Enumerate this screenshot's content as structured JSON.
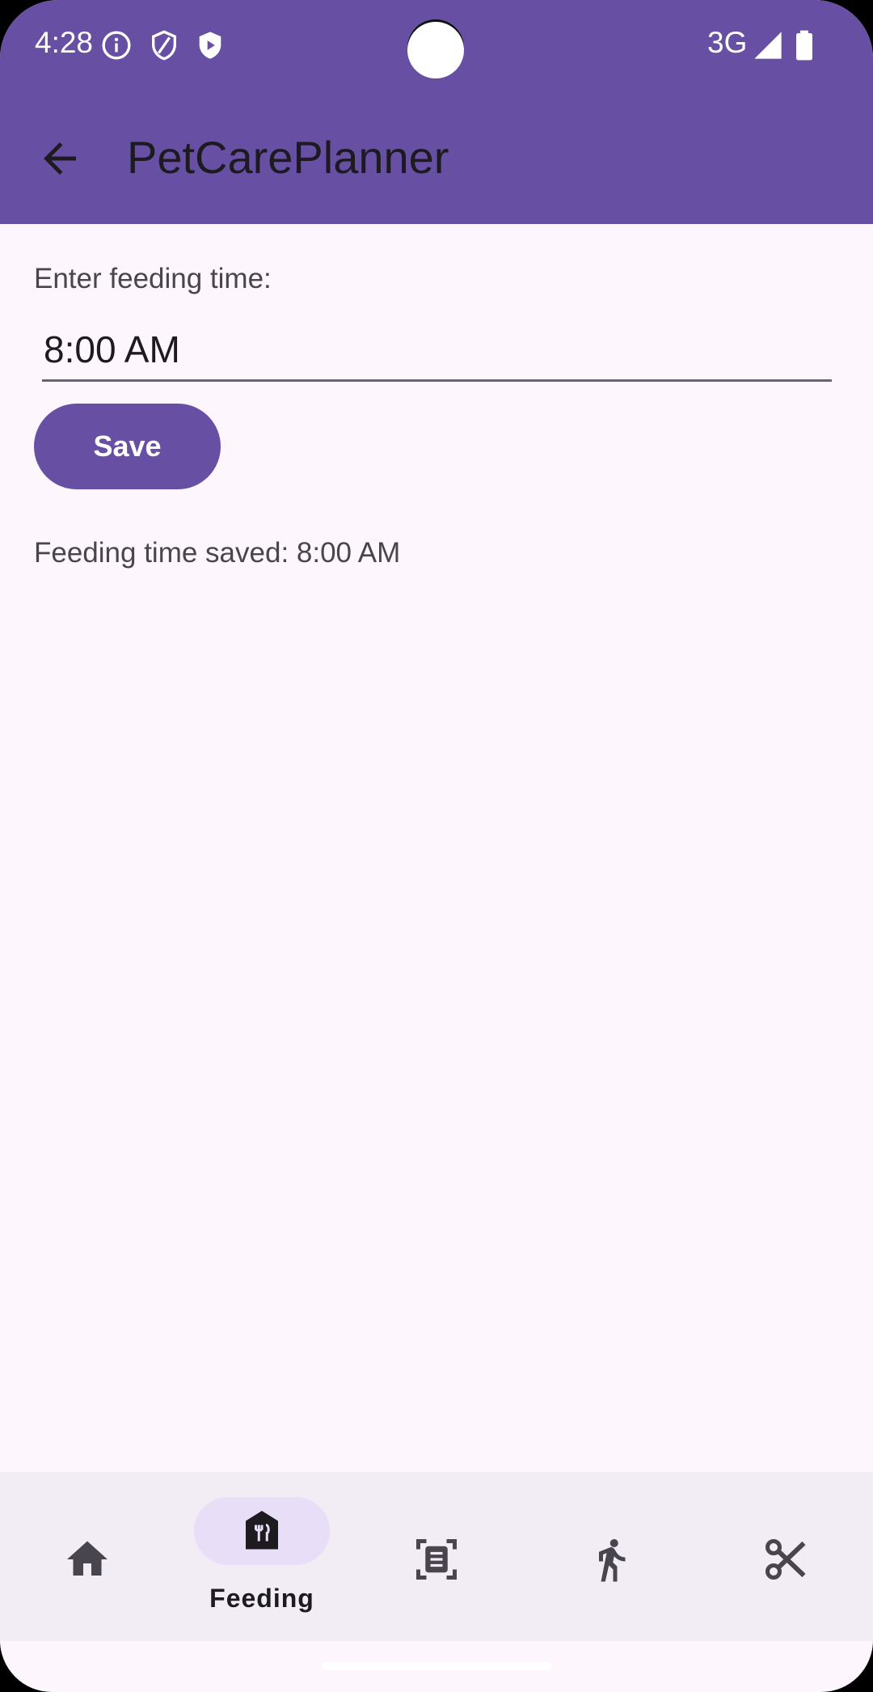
{
  "status_bar": {
    "time": "4:28",
    "network": "3G",
    "icons": [
      "info-icon",
      "shield-icon",
      "shield-play-icon",
      "signal-icon",
      "battery-icon"
    ]
  },
  "app_bar": {
    "title": "PetCarePlanner",
    "back_icon": "arrow-back-icon"
  },
  "form": {
    "label": "Enter feeding time:",
    "input_value": "8:00 AM",
    "save_label": "Save",
    "result_message": "Feeding time saved: 8:00 AM"
  },
  "bottom_nav": {
    "items": [
      {
        "icon": "home-icon",
        "label": "",
        "selected": false
      },
      {
        "icon": "feeding-icon",
        "label": "Feeding",
        "selected": true
      },
      {
        "icon": "document-scan-icon",
        "label": "",
        "selected": false
      },
      {
        "icon": "walk-icon",
        "label": "",
        "selected": false
      },
      {
        "icon": "scissors-icon",
        "label": "",
        "selected": false
      }
    ]
  },
  "colors": {
    "primary": "#6750a4",
    "background": "#fdf7fd",
    "nav_background": "#f2ecf4",
    "indicator": "#e8def8"
  }
}
